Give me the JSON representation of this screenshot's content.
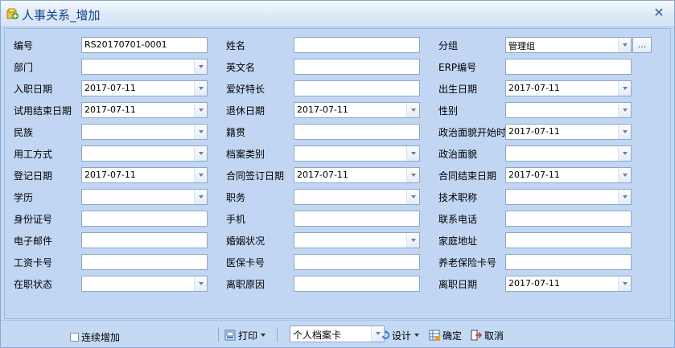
{
  "window": {
    "title": "人事关系_增加"
  },
  "fields": {
    "bianhao": {
      "label": "编号",
      "value": "RS20170701-0001"
    },
    "xingming": {
      "label": "姓名",
      "value": ""
    },
    "fenzu": {
      "label": "分组",
      "value": "管理组",
      "browse": "..."
    },
    "bumen": {
      "label": "部门",
      "value": ""
    },
    "yingwenming": {
      "label": "英文名",
      "value": ""
    },
    "erp": {
      "label": "ERP编号",
      "value": ""
    },
    "ruzhi": {
      "label": "入职日期",
      "value": "2017-07-11"
    },
    "aihao": {
      "label": "爱好特长",
      "value": ""
    },
    "chusheng": {
      "label": "出生日期",
      "value": "2017-07-11"
    },
    "shiyong": {
      "label": "试用结束日期",
      "value": "2017-07-11"
    },
    "tuixiu": {
      "label": "退休日期",
      "value": "2017-07-11"
    },
    "xingbie": {
      "label": "性别",
      "value": ""
    },
    "minzu": {
      "label": "民族",
      "value": ""
    },
    "jiguan": {
      "label": "籍贯",
      "value": ""
    },
    "zhengzhi_start": {
      "label": "政治面貌开始时",
      "value": "2017-07-11"
    },
    "yonggong": {
      "label": "用工方式",
      "value": ""
    },
    "dangan": {
      "label": "档案类别",
      "value": ""
    },
    "zhengzhi": {
      "label": "政治面貌",
      "value": ""
    },
    "dengji": {
      "label": "登记日期",
      "value": "2017-07-11"
    },
    "hetong_qd": {
      "label": "合同签订日期",
      "value": "2017-07-11"
    },
    "hetong_js": {
      "label": "合同结束日期",
      "value": "2017-07-11"
    },
    "xueli": {
      "label": "学历",
      "value": ""
    },
    "zhiwu": {
      "label": "职务",
      "value": ""
    },
    "jishu": {
      "label": "技术职称",
      "value": ""
    },
    "shenfen": {
      "label": "身份证号",
      "value": ""
    },
    "shouji": {
      "label": "手机",
      "value": ""
    },
    "lianxi": {
      "label": "联系电话",
      "value": ""
    },
    "email": {
      "label": "电子邮件",
      "value": ""
    },
    "hunyin": {
      "label": "婚姻状况",
      "value": ""
    },
    "jiating": {
      "label": "家庭地址",
      "value": ""
    },
    "gongzi": {
      "label": "工资卡号",
      "value": ""
    },
    "yibao": {
      "label": "医保卡号",
      "value": ""
    },
    "yanglao": {
      "label": "养老保险卡号",
      "value": ""
    },
    "zaizhi": {
      "label": "在职状态",
      "value": ""
    },
    "lizhi_yy": {
      "label": "离职原因",
      "value": ""
    },
    "lizhi_rq": {
      "label": "离职日期",
      "value": "2017-07-11"
    }
  },
  "bottom": {
    "continuous": "连续增加",
    "print": "打印",
    "template": "个人档案卡",
    "design": "设计",
    "ok": "确定",
    "cancel": "取消"
  },
  "colors": {
    "title_text": "#15428b",
    "panel": "#c1d6f3",
    "border": "#8fa7c6"
  }
}
